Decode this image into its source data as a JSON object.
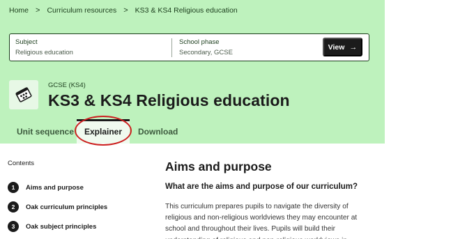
{
  "breadcrumb": {
    "items": [
      "Home",
      "Curriculum resources",
      "KS3 & KS4 Religious education"
    ],
    "separator": ">"
  },
  "filters": {
    "subject_label": "Subject",
    "subject_value": "Religious education",
    "phase_label": "School phase",
    "phase_value": "Secondary, GCSE",
    "view_button": "View",
    "view_arrow": "→"
  },
  "header": {
    "icon": "religious-education-icon",
    "eyebrow": "GCSE (KS4)",
    "title": "KS3 & KS4 Religious education"
  },
  "tabs": [
    {
      "label": "Unit sequence",
      "active": false
    },
    {
      "label": "Explainer",
      "active": true
    },
    {
      "label": "Download",
      "active": false
    }
  ],
  "sidebar": {
    "title": "Contents",
    "items": [
      {
        "number": "1",
        "label": "Aims and purpose"
      },
      {
        "number": "2",
        "label": "Oak curriculum principles"
      },
      {
        "number": "3",
        "label": "Oak subject principles"
      }
    ]
  },
  "main": {
    "heading": "Aims and purpose",
    "subheading": "What are the aims and purpose of our curriculum?",
    "body": "This curriculum prepares pupils to navigate the diversity of religious and non-religious worldviews they may encounter at school and throughout their lives. Pupils will build their understanding of religious and non-religious worldviews in"
  },
  "colors": {
    "hero_background": "#bef2bd",
    "active_tab_background": "#f0faef",
    "highlight_annotation": "#cc1f1f",
    "dark": "#1b1b1b"
  }
}
